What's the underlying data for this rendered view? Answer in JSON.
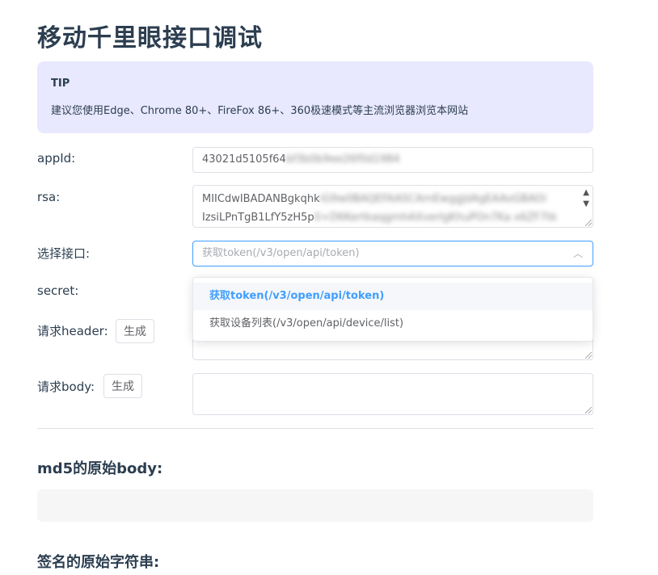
{
  "page_title": "移动千里眼接口调试",
  "tip": {
    "title": "TIP",
    "text": "建议您使用Edge、Chrome 80+、FireFox 86+、360极速模式等主流浏览器浏览本网站"
  },
  "form": {
    "appid": {
      "label": "appId:",
      "value_visible": "43021d5105f64",
      "value_blurred": "bf3b0b9ee26f0d1984"
    },
    "rsa": {
      "label": "rsa:",
      "line1_visible": "MIICdwIBADANBgkqhk",
      "line1_blurred": "iG9w0BAQEFAASCAmEwggJdAgEAAoGBAOi",
      "line2_visible": "IzsiLPnTgB1LfY5zH5p",
      "line2_blurred": "0+D6KertkaqgmhAXverlgKhuPOn7Ka x6ZF7tk"
    },
    "interface": {
      "label": "选择接口:",
      "placeholder": "获取token(/v3/open/api/token)",
      "options": [
        "获取token(/v3/open/api/token)",
        "获取设备列表(/v3/open/api/device/list)"
      ]
    },
    "secret": {
      "label": "secret:"
    },
    "header": {
      "label": "请求header:",
      "button": "生成"
    },
    "body": {
      "label": "请求body:",
      "button": "生成"
    }
  },
  "sections": {
    "md5_title": "md5的原始body:",
    "sign_title": "签名的原始字符串:"
  },
  "colors": {
    "accent": "#409eff",
    "tip_bg": "#e8e8ff",
    "text": "#2c3e50"
  }
}
